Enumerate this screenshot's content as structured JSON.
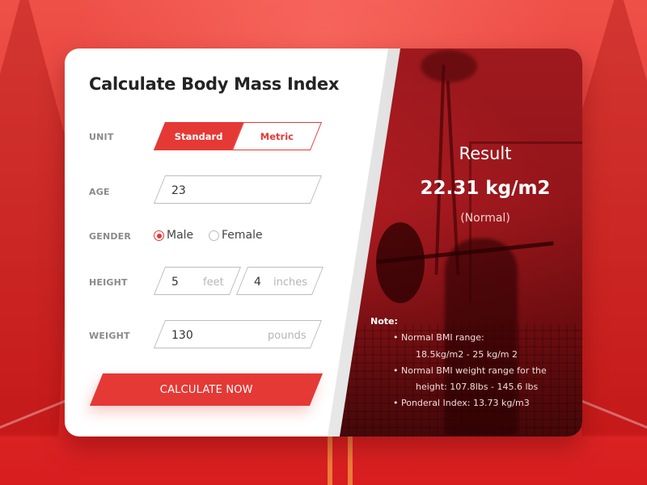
{
  "title": "Calculate Body Mass Index",
  "colors": {
    "accent": "#e53935",
    "panel": "#c9242b",
    "text_dark": "#232323",
    "label": "#8a8a8a"
  },
  "form": {
    "unit": {
      "label": "UNIT",
      "options": [
        "Standard",
        "Metric"
      ],
      "selected": "Standard"
    },
    "age": {
      "label": "AGE",
      "value": "23"
    },
    "gender": {
      "label": "GENDER",
      "options": [
        "Male",
        "Female"
      ],
      "selected": "Male"
    },
    "height": {
      "label": "HEIGHT",
      "feet_value": "5",
      "feet_unit": "feet",
      "inches_value": "4",
      "inches_unit": "inches"
    },
    "weight": {
      "label": "WEIGHT",
      "value": "130",
      "unit": "pounds"
    },
    "submit_label": "CALCULATE NOW"
  },
  "result": {
    "heading": "Result",
    "value": "22.31 kg/m2",
    "category": "(Normal)"
  },
  "notes": {
    "label": "Note:",
    "lines": [
      "• Normal BMI range:",
      "18.5kg/m2 - 25 kg/m 2",
      "• Normal BMI weight range for the",
      "height: 107.8lbs - 145.6 lbs",
      "• Ponderal Index: 13.73 kg/m3"
    ]
  }
}
